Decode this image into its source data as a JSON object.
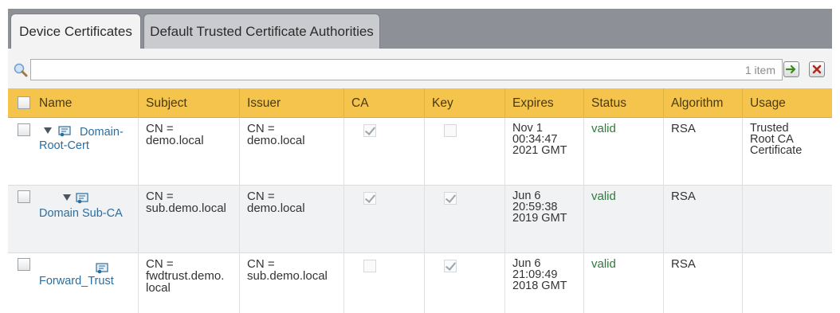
{
  "tabs": [
    {
      "label": "Device Certificates"
    },
    {
      "label": "Default Trusted Certificate Authorities"
    }
  ],
  "toolbar": {
    "search_value": "",
    "item_count": "1 item"
  },
  "columns": [
    "Name",
    "Subject",
    "Issuer",
    "CA",
    "Key",
    "Expires",
    "Status",
    "Algorithm",
    "Usage"
  ],
  "rows": [
    {
      "name_line1": "Domain-",
      "name_line2": "Root-Cert",
      "subject_line1": "CN =",
      "subject_line2": "demo.local",
      "subject_line3": "",
      "issuer_line1": "CN =",
      "issuer_line2": "demo.local",
      "ca": true,
      "key": false,
      "expires_line1": "Nov 1",
      "expires_line2": "00:34:47",
      "expires_line3": "2021 GMT",
      "status": "valid",
      "algorithm": "RSA",
      "usage_line1": "Trusted",
      "usage_line2": "Root CA",
      "usage_line3": "Certificate"
    },
    {
      "name_line1": "",
      "name_line2": "Domain Sub-CA",
      "subject_line1": "CN =",
      "subject_line2": "sub.demo.local",
      "subject_line3": "",
      "issuer_line1": "CN =",
      "issuer_line2": "demo.local",
      "ca": true,
      "key": true,
      "expires_line1": "Jun 6",
      "expires_line2": "20:59:38",
      "expires_line3": "2019 GMT",
      "status": "valid",
      "algorithm": "RSA",
      "usage_line1": "",
      "usage_line2": "",
      "usage_line3": ""
    },
    {
      "name_line1": "",
      "name_line2": "Forward_Trust",
      "subject_line1": "CN =",
      "subject_line2": "fwdtrust.demo.",
      "subject_line3": "local",
      "issuer_line1": "CN =",
      "issuer_line2": "sub.demo.local",
      "ca": false,
      "key": true,
      "expires_line1": "Jun 6",
      "expires_line2": "21:09:49",
      "expires_line3": "2018 GMT",
      "status": "valid",
      "algorithm": "RSA",
      "usage_line1": "",
      "usage_line2": "",
      "usage_line3": ""
    }
  ],
  "colors": {
    "header_bg": "#f5c44c",
    "tabbar_bg": "#8d9197",
    "link": "#2d6d9c",
    "valid": "#2f7a3a"
  }
}
